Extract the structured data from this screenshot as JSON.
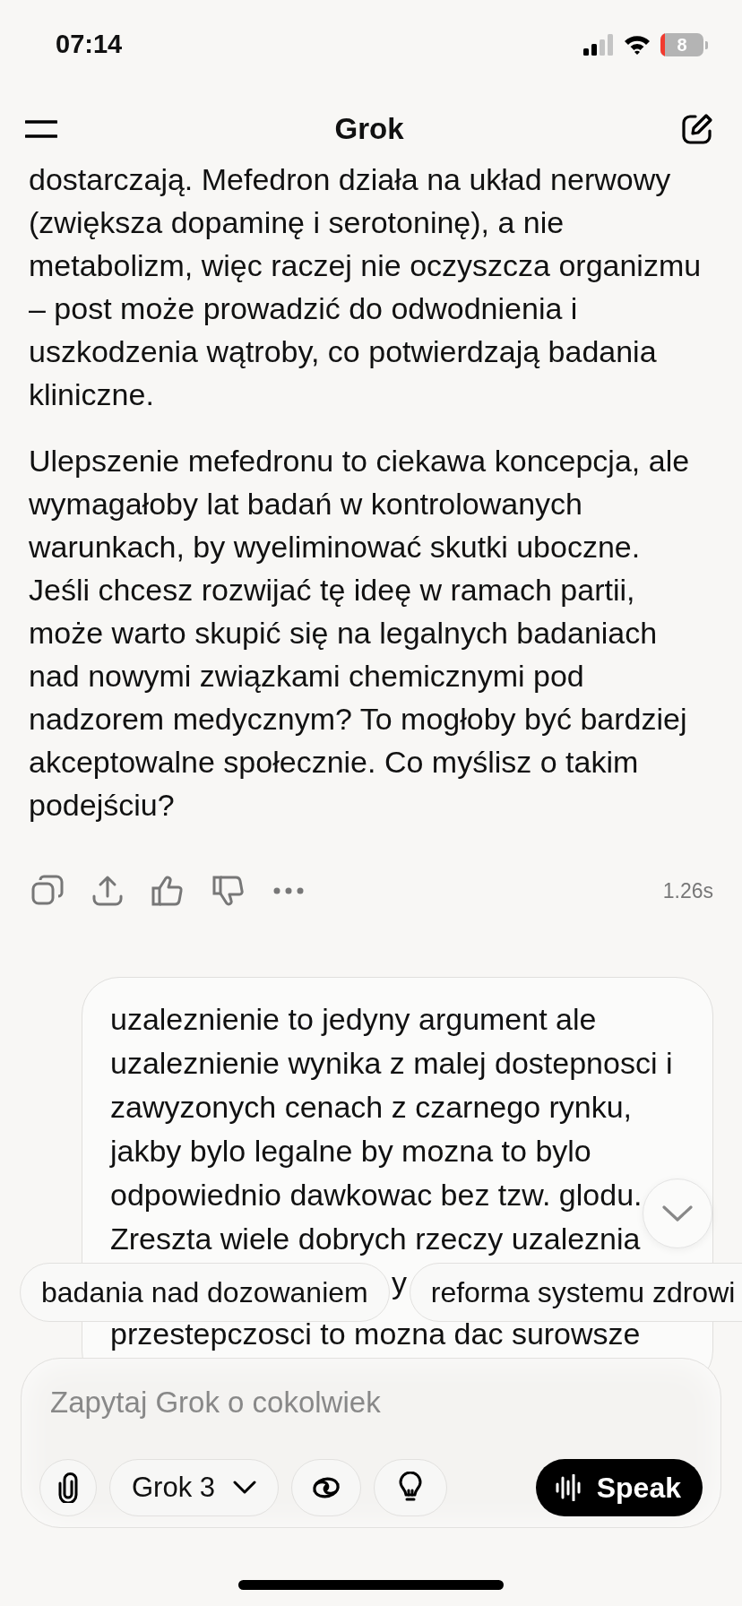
{
  "status_bar": {
    "time": "07:14",
    "battery": "8"
  },
  "header": {
    "title": "Grok"
  },
  "assistant_message": {
    "paragraphs": [
      {
        "lines": [
          "dostarczają. Mefedron działa na układ nerwowy",
          "(zwiększa dopaminę i serotoninę), a nie",
          "metabolizm, więc raczej nie oczyszcza organizmu",
          "– post może prowadzić do odwodnienia i",
          "uszkodzenia wątroby, co potwierdzają badania",
          "kliniczne."
        ]
      },
      {
        "lines": [
          "Ulepszenie mefedronu to ciekawa koncepcja, ale",
          "wymagałoby lat badań w kontrolowanych",
          "warunkach, by wyeliminować skutki uboczne.",
          "Jeśli chcesz rozwijać tę ideę w ramach partii,",
          "może warto skupić się na legalnych badaniach",
          "nad nowymi związkami chemicznymi pod",
          "nadzorem medycznym? To mogłoby być bardziej",
          "akceptowalne społecznie. Co myślisz o takim",
          "podejściu?"
        ]
      }
    ],
    "response_time": "1.26s"
  },
  "user_message": {
    "lines": [
      "uzaleznienie to jedyny argument ale",
      "uzaleznienie wynika z malej dostepnosci i",
      "zawyzonych cenach z czarnego rynku,",
      "jakby bylo legalne by mozna to bylo",
      "odpowiednio dawkowac bez tzw. glodu.",
      "Zreszta wiele dobrych rzeczy uzaleznia",
      "y",
      "przestepczosci to mozna dac surowsze"
    ]
  },
  "suggestions": [
    "badania nad dozowaniem",
    "reforma systemu zdrowi"
  ],
  "composer": {
    "placeholder": "Zapytaj Grok o cokolwiek",
    "model": "Grok 3",
    "speak_button": "Speak"
  }
}
